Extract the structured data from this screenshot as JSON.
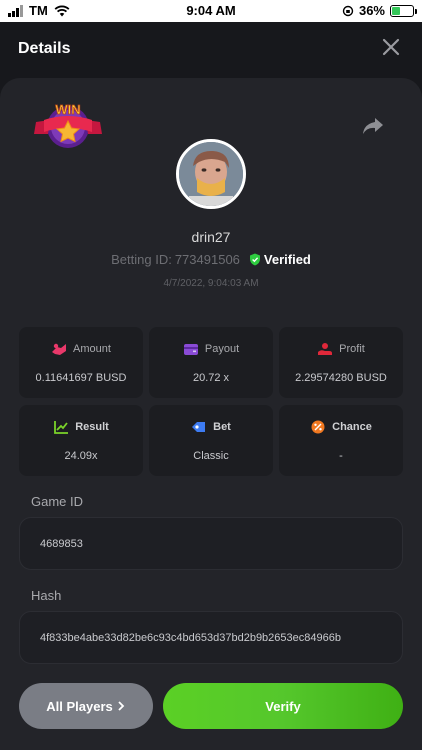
{
  "status_bar": {
    "carrier": "TM",
    "time": "9:04 AM",
    "battery": "36%"
  },
  "header": {
    "title": "Details"
  },
  "badge": {
    "text": "WIN"
  },
  "player": {
    "username": "drin27",
    "betting_id_label": "Betting ID:",
    "betting_id": "773491506",
    "verified_label": "Verified",
    "date": "4/7/2022, 9:04:03 AM"
  },
  "stats": {
    "amount": {
      "label": "Amount",
      "value": "0.11641697 BUSD"
    },
    "payout": {
      "label": "Payout",
      "value": "20.72 x"
    },
    "profit": {
      "label": "Profit",
      "value": "2.29574280 BUSD"
    },
    "result": {
      "label": "Result",
      "value": "24.09x"
    },
    "bet": {
      "label": "Bet",
      "value": "Classic"
    },
    "chance": {
      "label": "Chance",
      "value": "-"
    }
  },
  "game_id": {
    "label": "Game ID",
    "value": "4689853"
  },
  "hash": {
    "label": "Hash",
    "value": "4f833be4abe33d82be6c93c4bd653d37bd2b9b2653ec84966b"
  },
  "buttons": {
    "all_players": "All Players",
    "verify": "Verify"
  },
  "colors": {
    "background": "#17181c",
    "card": "#232429",
    "tile": "#1c1d21",
    "verify_green": "#55c72c",
    "verified_green": "#2ecc40",
    "amount_icon": "#e9386a",
    "payout_icon": "#8a4bd6",
    "profit_icon": "#e0283a",
    "result_icon": "#7bd32a",
    "bet_icon": "#3d7bf2",
    "chance_icon": "#f07820"
  }
}
